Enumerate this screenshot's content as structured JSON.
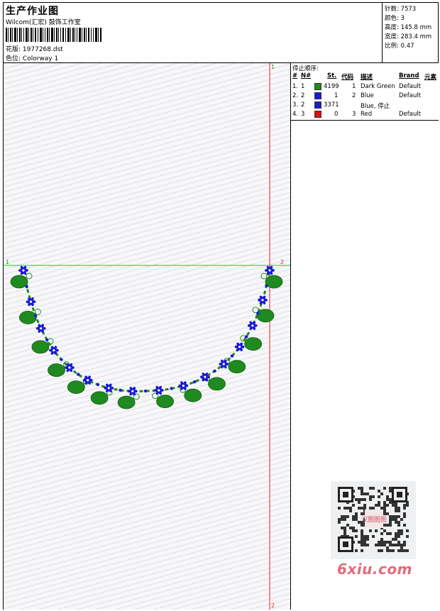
{
  "header": {
    "title": "生产作业图",
    "company": "Wilcom(汇宏) 鼓饰工作室",
    "design_label": "花版:",
    "design_value": "1977268.dst",
    "colorway_label": "色位:",
    "colorway_value": "Colorway 1"
  },
  "stats": [
    {
      "label": "针数:",
      "value": "7573"
    },
    {
      "label": "颜色:",
      "value": "3"
    },
    {
      "label": "高度:",
      "value": "145.8 mm"
    },
    {
      "label": "宽度:",
      "value": "283.4 mm"
    },
    {
      "label": "比例:",
      "value": "0.47"
    }
  ],
  "stop_sequence": {
    "title": "停止顺序:",
    "columns": [
      "#",
      "N#",
      "St.",
      "代码",
      "描述",
      "Brand",
      "元素"
    ],
    "rows": [
      {
        "num": "1.",
        "n": "1",
        "stitches": "4199",
        "code": "1",
        "description": "Dark Green",
        "brand": "Default",
        "color": "#1f8a1f"
      },
      {
        "num": "2.",
        "n": "2",
        "stitches": "1",
        "code": "2",
        "description": "Blue",
        "brand": "Default",
        "color": "#1a1ad6"
      },
      {
        "num": "3.",
        "n": "2",
        "stitches": "3371",
        "code": "",
        "description": "Blue, 停止",
        "brand": "",
        "color": "#1a1ad6"
      },
      {
        "num": "4.",
        "n": "3",
        "stitches": "0",
        "code": "3",
        "description": "Red",
        "brand": "Default",
        "color": "#e01010"
      }
    ]
  },
  "markers": {
    "v_top": "1",
    "v_bottom": "2",
    "h_left": "1",
    "h_right": "2"
  },
  "watermark": {
    "site": "6xiu.com",
    "seal": "汉图图图"
  },
  "colors": {
    "green": "#1f8a1f",
    "blue": "#1a1ad6",
    "red_guide": "#e02020",
    "green_guide": "#22cc22"
  }
}
